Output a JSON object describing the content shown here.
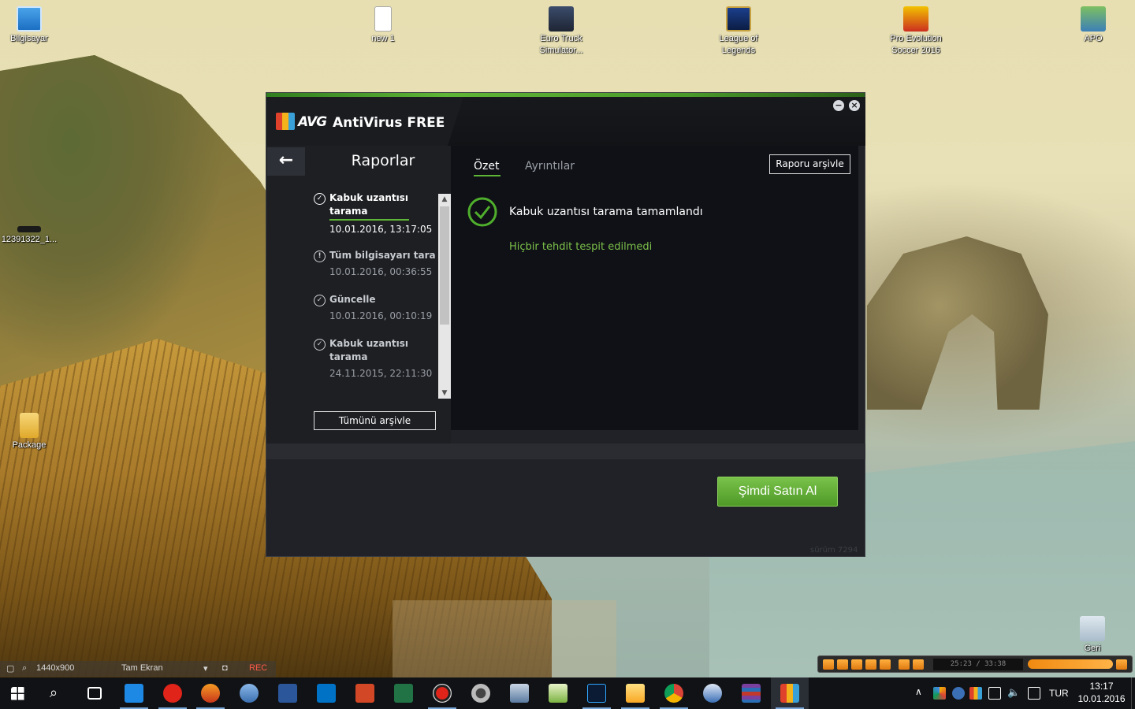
{
  "desktop": {
    "icons": [
      {
        "label": "Bilgisayar",
        "icon": "computer-icon"
      },
      {
        "label": "new 1",
        "icon": "text-file-icon"
      },
      {
        "label": "Euro Truck Simulator...",
        "icon": "euro-truck-icon"
      },
      {
        "label": "League of Legends",
        "icon": "league-of-legends-icon"
      },
      {
        "label": "Pro Evolution Soccer 2016",
        "icon": "pes-icon"
      },
      {
        "label": "APO",
        "icon": "user-folder-icon"
      },
      {
        "label": "12391322_1...",
        "icon": "image-thumbnail-icon"
      },
      {
        "label": "Package",
        "icon": "folder-icon"
      },
      {
        "label": "Geri",
        "icon": "recycle-bin-icon"
      }
    ]
  },
  "avg": {
    "brand": "AVG",
    "product": "AntiVirus FREE",
    "minimize": "−",
    "close": "×",
    "back_arrow": "←",
    "left_title": "Raporlar",
    "reports": [
      {
        "name": "Kabuk uzantısı tarama",
        "date": "10.01.2016, 13:17:05",
        "status_icon": "check",
        "active": true
      },
      {
        "name": "Tüm bilgisayarı tara",
        "date": "10.01.2016, 00:36:55",
        "status_icon": "warning",
        "active": false
      },
      {
        "name": "Güncelle",
        "date": "10.01.2016, 00:10:19",
        "status_icon": "check",
        "active": false
      },
      {
        "name": "Kabuk uzantısı tarama",
        "date": "24.11.2015, 22:11:30",
        "status_icon": "check",
        "active": false
      }
    ],
    "archive_all": "Tümünü arşivle",
    "tabs": {
      "summary": "Özet",
      "details": "Ayrıntılar"
    },
    "archive_report": "Raporu arşivle",
    "scan_title": "Kabuk uzantısı tarama tamamlandı",
    "scan_result": "Hiçbir tehdit tespit edilmedi",
    "buy_now": "Şimdi Satın Al",
    "version": "sürüm 7294",
    "colors": {
      "accent_green": "#5fb536",
      "result_green": "#7cc04a",
      "panel_dark": "#0f1116"
    }
  },
  "recorder": {
    "resolution": "1440x900",
    "fullscreen": "Tam Ekran",
    "rec": "REC"
  },
  "media_player": {
    "time": "25:23 / 33:38"
  },
  "taskbar": {
    "apps": [
      "start",
      "search",
      "task-view",
      "edge",
      "opera",
      "firefox",
      "pinball",
      "word",
      "outlook",
      "powerpoint",
      "excel",
      "recorder",
      "camera",
      "network-app",
      "notepad",
      "photoshop",
      "file-explorer",
      "chrome",
      "camera-app",
      "winrar",
      "avg"
    ],
    "language": "TUR",
    "time": "13:17",
    "date": "10.01.2016"
  }
}
